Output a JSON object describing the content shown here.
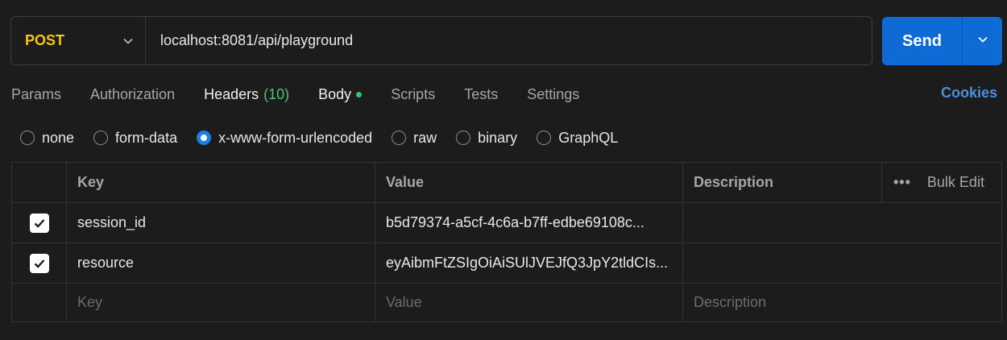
{
  "request": {
    "method": "POST",
    "url": "localhost:8081/api/playground",
    "send_label": "Send"
  },
  "tabs": [
    {
      "label": "Params"
    },
    {
      "label": "Authorization"
    },
    {
      "label": "Headers",
      "count": "(10)"
    },
    {
      "label": "Body"
    },
    {
      "label": "Scripts"
    },
    {
      "label": "Tests"
    },
    {
      "label": "Settings"
    }
  ],
  "cookies_label": "Cookies",
  "body_types": {
    "options": [
      "none",
      "form-data",
      "x-www-form-urlencoded",
      "raw",
      "binary",
      "GraphQL"
    ],
    "selected": "x-www-form-urlencoded"
  },
  "table": {
    "headers": {
      "key": "Key",
      "value": "Value",
      "description": "Description",
      "bulk_edit": "Bulk Edit"
    },
    "rows": [
      {
        "checked": true,
        "key": "session_id",
        "value": "b5d79374-a5cf-4c6a-b7ff-edbe69108c...",
        "description": ""
      },
      {
        "checked": true,
        "key": "resource",
        "value": "eyAibmFtZSIgOiAiSUlJVEJfQ3JpY2tldCIs...",
        "description": ""
      }
    ],
    "placeholders": {
      "key": "Key",
      "value": "Value",
      "description": "Description"
    }
  },
  "colors": {
    "method": "#f5c518",
    "send": "#0e6bd6",
    "accent_link": "#4a90e2",
    "headers_count": "#4fc46b",
    "body_dot": "#35c46d"
  }
}
